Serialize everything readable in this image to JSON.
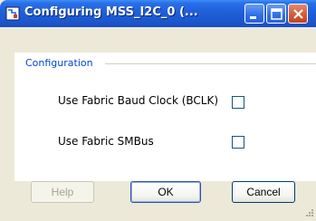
{
  "window": {
    "title": "Configuring MSS_I2C_0 (...",
    "icon": "app-icon",
    "controls": [
      "minimize-icon",
      "maximize-icon",
      "close-icon"
    ],
    "title_color": "#ffffff",
    "titlebar_color": "#1f5fd8"
  },
  "group": {
    "title": "Configuration",
    "title_color": "#0046d5"
  },
  "options": [
    {
      "label": "Use Fabric Baud Clock (BCLK)",
      "checked": false
    },
    {
      "label": "Use Fabric SMBus",
      "checked": false
    }
  ],
  "buttons": {
    "help": {
      "label": "Help",
      "enabled": false
    },
    "ok": {
      "label": "OK",
      "enabled": true,
      "default": true
    },
    "cancel": {
      "label": "Cancel",
      "enabled": true
    }
  }
}
